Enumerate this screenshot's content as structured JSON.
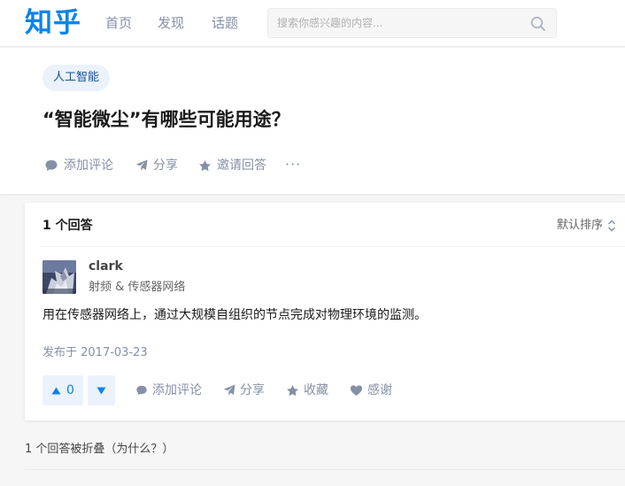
{
  "brand": {
    "logo": "知乎",
    "accent": "#0a84e8"
  },
  "nav": {
    "home": "首页",
    "discover": "发现",
    "topics": "话题"
  },
  "search": {
    "placeholder": "搜索你感兴趣的内容..."
  },
  "question": {
    "topic": "人工智能",
    "title": "“智能微尘”有哪些可能用途？",
    "actions": {
      "comment": "添加评论",
      "share": "分享",
      "invite": "邀请回答",
      "more": "···"
    }
  },
  "answers": {
    "count_label": "1 个回答",
    "sort_label": "默认排序",
    "items": [
      {
        "author": "clark",
        "bio": "射频 & 传感器网络",
        "content": "用在传感器网络上，通过大规模自组织的节点完成对物理环境的监测。",
        "published": "发布于 2017-03-23",
        "upvotes": "0",
        "actions": {
          "comment": "添加评论",
          "share": "分享",
          "collect": "收藏",
          "thanks": "感谢"
        }
      }
    ]
  },
  "collapsed_note": "1 个回答被折叠（为什么？）"
}
